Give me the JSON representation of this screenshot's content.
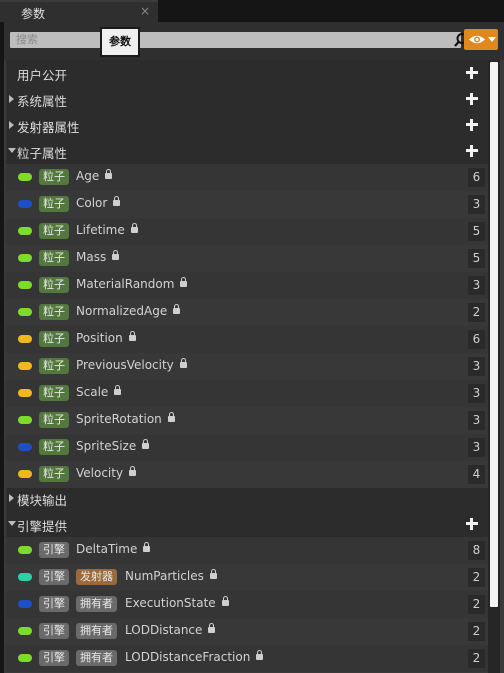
{
  "tab": {
    "title": "参数",
    "close": "×"
  },
  "search": {
    "placeholder": "搜索",
    "tooltip": "参数"
  },
  "categories": {
    "user": {
      "label": "用户公开"
    },
    "system": {
      "label": "系统属性"
    },
    "emitter": {
      "label": "发射器属性"
    },
    "particle": {
      "label": "粒子属性"
    },
    "module": {
      "label": "模块输出"
    },
    "engine": {
      "label": "引擎提供"
    }
  },
  "particle_params": [
    {
      "tag": "粒子",
      "name": "Age",
      "count": "6",
      "color": "#7ddc2a"
    },
    {
      "tag": "粒子",
      "name": "Color",
      "count": "3",
      "color": "#1f4fc4"
    },
    {
      "tag": "粒子",
      "name": "Lifetime",
      "count": "5",
      "color": "#7ddc2a"
    },
    {
      "tag": "粒子",
      "name": "Mass",
      "count": "5",
      "color": "#7ddc2a"
    },
    {
      "tag": "粒子",
      "name": "MaterialRandom",
      "count": "3",
      "color": "#7ddc2a"
    },
    {
      "tag": "粒子",
      "name": "NormalizedAge",
      "count": "2",
      "color": "#7ddc2a"
    },
    {
      "tag": "粒子",
      "name": "Position",
      "count": "6",
      "color": "#f0b81d"
    },
    {
      "tag": "粒子",
      "name": "PreviousVelocity",
      "count": "3",
      "color": "#f0b81d"
    },
    {
      "tag": "粒子",
      "name": "Scale",
      "count": "3",
      "color": "#f0b81d"
    },
    {
      "tag": "粒子",
      "name": "SpriteRotation",
      "count": "3",
      "color": "#7ddc2a"
    },
    {
      "tag": "粒子",
      "name": "SpriteSize",
      "count": "3",
      "color": "#1f4fc4"
    },
    {
      "tag": "粒子",
      "name": "Velocity",
      "count": "4",
      "color": "#f0b81d"
    }
  ],
  "engine_params": [
    {
      "tag": "引擎",
      "sub": "",
      "name": "DeltaTime",
      "count": "8",
      "color": "#7ddc2a"
    },
    {
      "tag": "引擎",
      "sub": "发射器",
      "name": "NumParticles",
      "count": "2",
      "color": "#2ed1a5"
    },
    {
      "tag": "引擎",
      "sub": "拥有者",
      "name": "ExecutionState",
      "count": "2",
      "color": "#1f4fc4"
    },
    {
      "tag": "引擎",
      "sub": "拥有者",
      "name": "LODDistance",
      "count": "2",
      "color": "#7ddc2a"
    },
    {
      "tag": "引擎",
      "sub": "拥有者",
      "name": "LODDistanceFraction",
      "count": "2",
      "color": "#7ddc2a"
    }
  ]
}
